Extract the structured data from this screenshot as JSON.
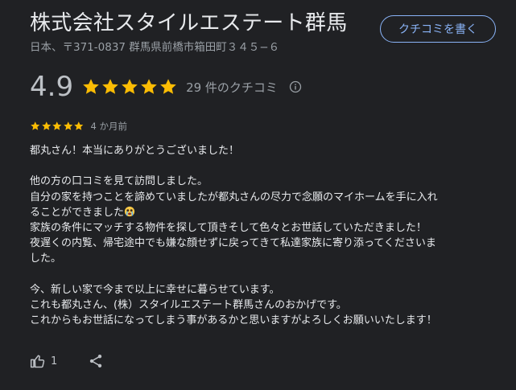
{
  "business": {
    "name": "株式会社スタイルエステート群馬",
    "address": "日本、〒371-0837 群馬県前橋市箱田町３４５−６"
  },
  "write_review_button": "クチコミを書く",
  "rating": {
    "value": "4.9",
    "stars": 5,
    "review_count": "29 件のクチコミ"
  },
  "review": {
    "stars": 5,
    "date": "4 か月前",
    "paragraphs": [
      [
        "都丸さん！本当にありがとうございました！"
      ],
      [
        "他の方の口コミを見て訪問しました。",
        "自分の家を持つことを諦めていましたが都丸さんの尽力で念願のマイホームを手に入れ",
        "ることができました",
        "家族の条件にマッチする物件を探して頂きそして色々とお世話していただきました！",
        "夜遅くの内覧、帰宅途中でも嫌な顔せずに戻ってきて私達家族に寄り添ってくださいま",
        "した。"
      ],
      [
        "今、新しい家で今まで以上に幸せに暮らせています。",
        "これも都丸さん、(株）スタイルエステート群馬さんのおかげです。",
        "これからもお世話になってしまう事があるかと思いますがよろしくお願いいたします！"
      ]
    ],
    "likes": "1"
  },
  "icons": {
    "star": "star-icon",
    "info": "info-icon",
    "like": "thumb-up-icon",
    "share": "share-icon",
    "emoji": "crying-face-icon"
  },
  "colors": {
    "background": "#202124",
    "star": "#fbbc04",
    "accent": "#8ab4f8",
    "text": "#e8eaed",
    "secondary": "#9aa0a6"
  }
}
